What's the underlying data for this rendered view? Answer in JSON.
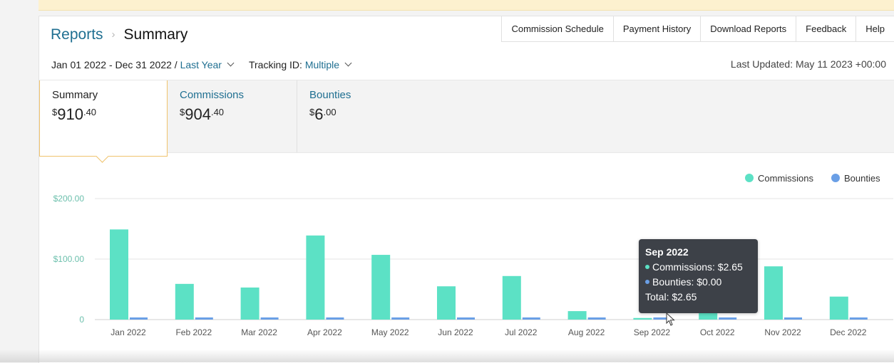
{
  "breadcrumb": {
    "reports": "Reports",
    "separator": "›",
    "current": "Summary"
  },
  "top_nav": [
    "Commission Schedule",
    "Payment History",
    "Download Reports",
    "Feedback",
    "Help"
  ],
  "filters": {
    "date_range": "Jan 01 2022 - Dec 31 2022 /",
    "period": "Last Year",
    "tracking_label": "Tracking ID:",
    "tracking_value": "Multiple"
  },
  "last_updated": "Last Updated: May 11 2023 +00:00",
  "tabs": [
    {
      "label": "Summary",
      "currency": "$",
      "whole": "910",
      "cents": ".40",
      "active": true
    },
    {
      "label": "Commissions",
      "currency": "$",
      "whole": "904",
      "cents": ".40",
      "active": false
    },
    {
      "label": "Bounties",
      "currency": "$",
      "whole": "6",
      "cents": ".00",
      "active": false
    }
  ],
  "colors": {
    "commissions": "#5ce1c5",
    "bounties": "#6a9fe6",
    "link": "#1f6f91",
    "accent_border": "#f0c36d"
  },
  "chart_data": {
    "type": "bar",
    "categories": [
      "Jan 2022",
      "Feb 2022",
      "Mar 2022",
      "Apr 2022",
      "May 2022",
      "Jun 2022",
      "Jul 2022",
      "Aug 2022",
      "Sep 2022",
      "Oct 2022",
      "Nov 2022",
      "Dec 2022"
    ],
    "series": [
      {
        "name": "Commissions",
        "values": [
          149,
          59,
          53,
          139,
          107,
          55,
          72,
          14,
          2.65,
          12,
          88,
          38
        ]
      },
      {
        "name": "Bounties",
        "values": [
          1.5,
          1.5,
          1.5,
          1.5,
          1.5,
          1.5,
          1.5,
          1.5,
          0,
          1.5,
          1.5,
          1.5
        ]
      }
    ],
    "y_ticks": [
      "0",
      "$100.00",
      "$200.00"
    ],
    "ylim": [
      0,
      200
    ],
    "grid": true,
    "legend": "top-right"
  },
  "tooltip": {
    "title": "Sep 2022",
    "commissions": "Commissions: $2.65",
    "bounties": "Bounties: $0.00",
    "total": "Total: $2.65"
  }
}
